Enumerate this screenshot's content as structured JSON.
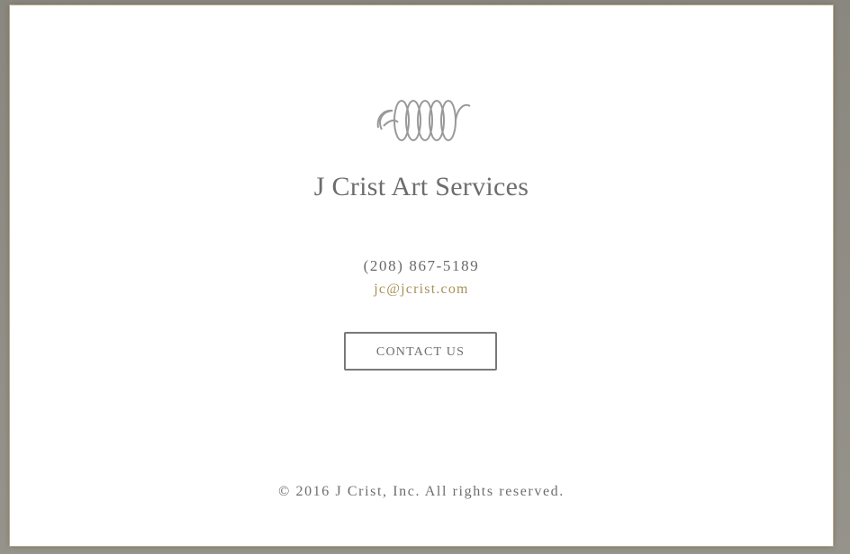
{
  "site": {
    "company_name": "J Crist Art Services",
    "phone": "(208) 867-5189",
    "email": "jc@jcrist.com",
    "contact_button_label": "CONTACT US",
    "copyright": "© 2016 J Crist, Inc. All rights reserved.",
    "logo_icon": "spiral-coil-logo"
  },
  "colors": {
    "text": "#6f6c6e",
    "email_accent": "#a8925a",
    "logo_stroke": "#9a9899",
    "button_border": "#7b787a",
    "page_background": "#ffffff",
    "frame_background": "#8f8c84"
  }
}
